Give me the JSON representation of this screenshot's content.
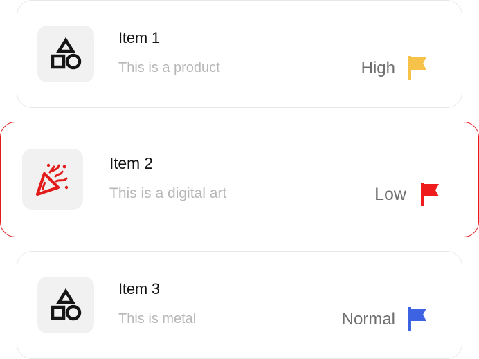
{
  "items": [
    {
      "title": "Item 1",
      "description": "This is a product",
      "priority": "High",
      "icon": "shapes-icon",
      "flag_color": "#f7c24a",
      "selected": false
    },
    {
      "title": "Item 2",
      "description": "This is a digital art",
      "priority": "Low",
      "icon": "party-popper-icon",
      "flag_color": "#ee1c1c",
      "selected": true
    },
    {
      "title": "Item 3",
      "description": "This is metal",
      "priority": "Normal",
      "icon": "shapes-icon",
      "flag_color": "#3d63e3",
      "selected": false
    }
  ],
  "colors": {
    "selected_border": "#e31b1b",
    "icon_dark": "#151515",
    "icon_accent": "#e31b1b"
  }
}
